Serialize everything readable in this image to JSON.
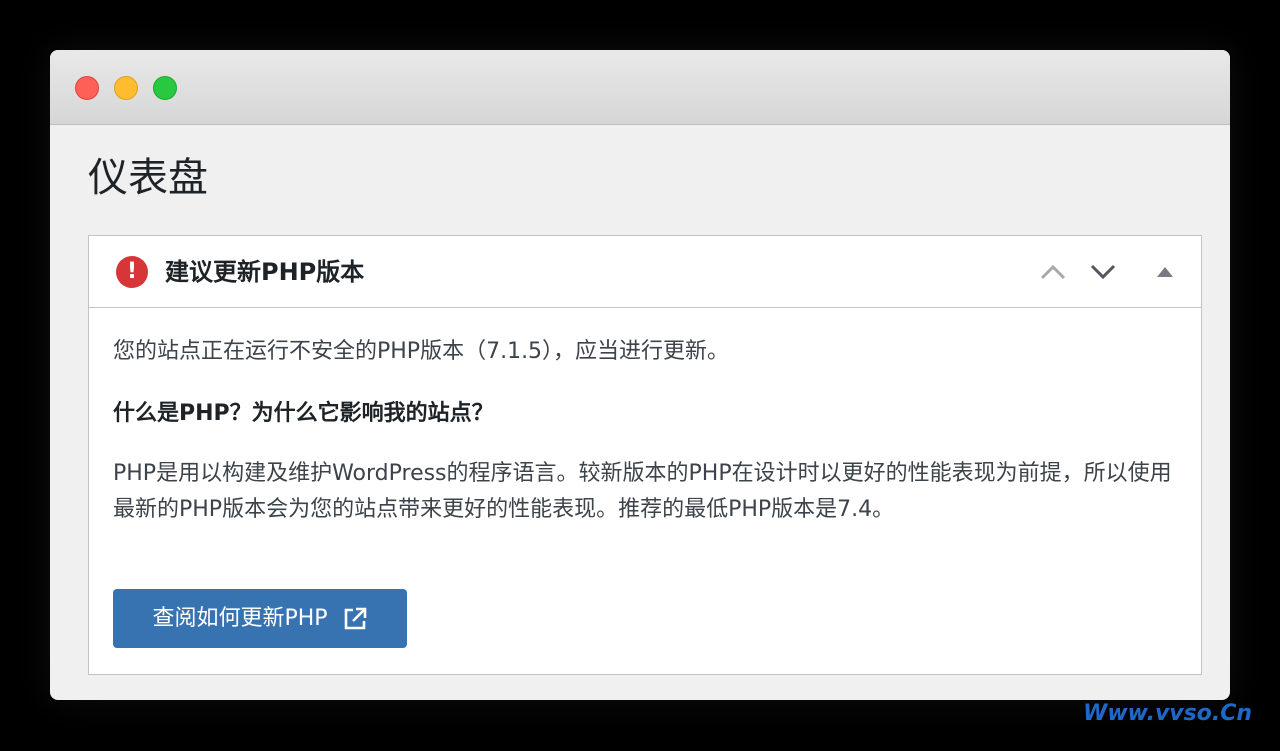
{
  "window": {
    "controls": [
      "close",
      "minimize",
      "zoom"
    ]
  },
  "page": {
    "title": "仪表盘"
  },
  "panel": {
    "icon": "exclamation-circle-icon",
    "title": "建议更新PHP版本",
    "controls": [
      "move-up-icon",
      "move-down-icon",
      "collapse-toggle-icon"
    ],
    "intro": "您的站点正在运行不安全的PHP版本（7.1.5），应当进行更新。",
    "subheading": "什么是PHP？为什么它影响我的站点？",
    "description": "PHP是用以构建及维护WordPress的程序语言。较新版本的PHP在设计时以更好的性能表现为前提，所以使用最新的PHP版本会为您的站点带来更好的性能表现。推荐的最低PHP版本是7.4。",
    "button_label": "查阅如何更新PHP",
    "button_icon": "external-link-icon"
  },
  "watermark": "Www.vvso.Cn",
  "colors": {
    "alert": "#d63638",
    "button": "#3873b1",
    "watermark": "#1f68c6"
  }
}
